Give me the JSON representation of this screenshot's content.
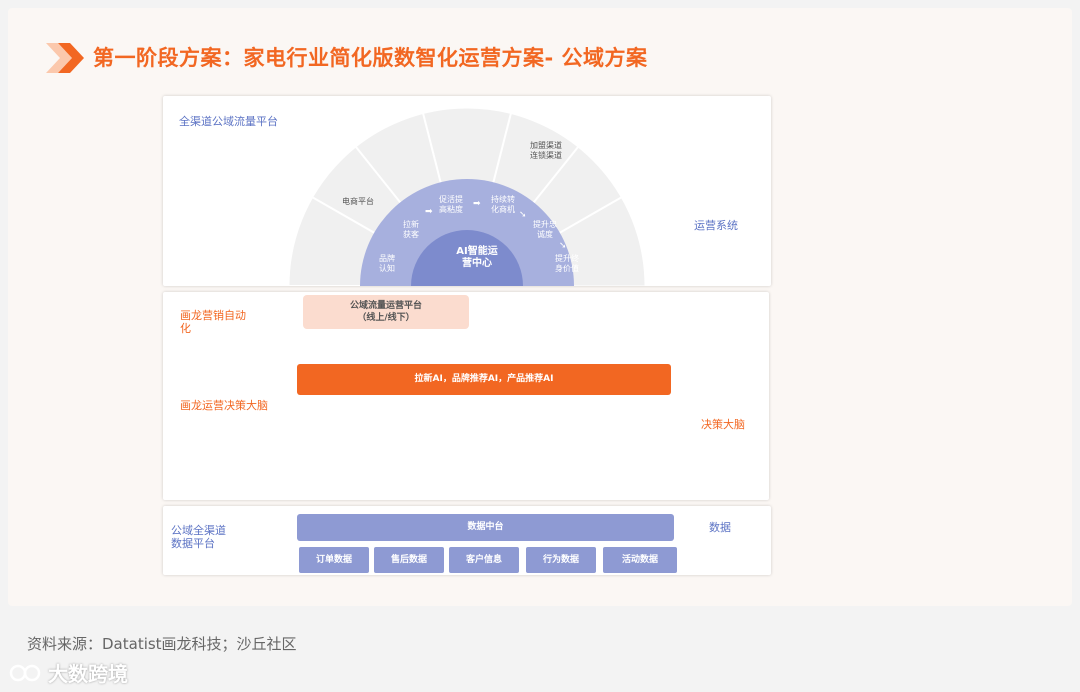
{
  "title": "第一阶段方案：家电行业简化版数智化运营方案- 公域方案",
  "panel_traffic": {
    "left_label": "全渠道公域流量平台",
    "right_label": "运营系统",
    "outer_segments": [
      "电商平台",
      "加盟渠道\n连锁渠道"
    ],
    "inner_segments": [
      "品牌\n认知",
      "拉新\n获客",
      "促活提\n高粘度",
      "持续转\n化商机",
      "提升忠\n诚度",
      "提升终\n身价值"
    ],
    "core": "AI智能运\n营中心"
  },
  "panel_ai": {
    "label_automation": "画龙营销自动\n化",
    "label_brain": "画龙运营决策大脑",
    "right_label": "决策大脑",
    "badge": "公域流量运营平台\n（线上/线下）",
    "ai_bar": "拉新AI，品牌推荐AI，产品推荐AI"
  },
  "panel_data": {
    "left_label": "公域全渠道\n数据平台",
    "right_label": "数据",
    "hub": "数据中台",
    "chips": [
      "订单数据",
      "售后数据",
      "客户信息",
      "行为数据",
      "活动数据"
    ]
  },
  "source": "资料来源：Datatist画龙科技；沙丘社区",
  "watermark": "大数跨境",
  "colors": {
    "orange": "#f26722",
    "blue_label": "#5c73c4",
    "bar_blue": "#8e9ad3",
    "badge_pink": "#fbdccf",
    "arc_outer": "#f0f0f0",
    "arc_inner": "#a7b0de",
    "arc_core": "#7d8bcd"
  }
}
